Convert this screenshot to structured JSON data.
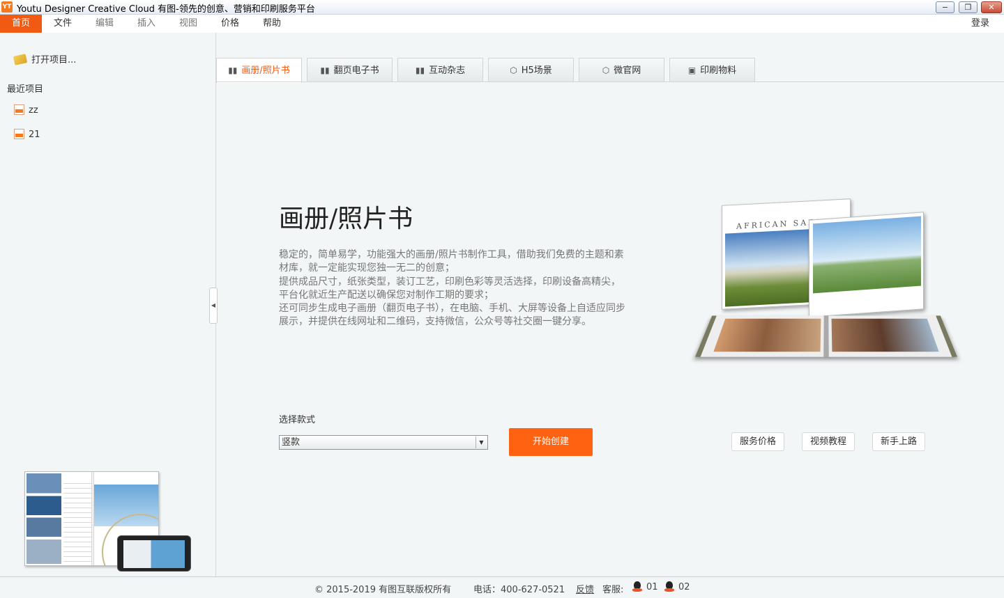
{
  "window": {
    "icon_text": "YT",
    "title": "Youtu Designer Creative Cloud 有图-领先的创意、营销和印刷服务平台",
    "min_symbol": "−",
    "max_symbol": "❐",
    "close_symbol": "✕"
  },
  "menu": {
    "items": [
      "首页",
      "文件",
      "编辑",
      "插入",
      "视图",
      "价格",
      "帮助"
    ],
    "login": "登录"
  },
  "sidebar": {
    "open_project": "打开项目...",
    "recent_title": "最近项目",
    "recent_items": [
      "zz",
      "21"
    ],
    "collapse_symbol": "◀"
  },
  "tabs": [
    {
      "label": "画册/照片书",
      "icon": "book-icon",
      "glyph": "▮▮"
    },
    {
      "label": "翻页电子书",
      "icon": "book-icon",
      "glyph": "▮▮"
    },
    {
      "label": "互动杂志",
      "icon": "book-icon",
      "glyph": "▮▮"
    },
    {
      "label": "H5场景",
      "icon": "html5-icon",
      "glyph": "⬡"
    },
    {
      "label": "微官网",
      "icon": "html5-icon",
      "glyph": "⬡"
    },
    {
      "label": "印刷物料",
      "icon": "print-icon",
      "glyph": "▣"
    }
  ],
  "main": {
    "title": "画册/照片书",
    "description": [
      "稳定的，简单易学，功能强大的画册/照片书制作工具，借助我们免费的主题和素材库，就一定能实现您独一无二的创意；",
      "提供成品尺寸，纸张类型，装订工艺，印刷色彩等灵活选择，印刷设备高精尖，平台化就近生产配送以确保您对制作工期的要求；",
      "还可同步生成电子画册（翻页电子书），在电脑、手机、大屏等设备上自适应同步展示，并提供在线网址和二维码，支持微信，公众号等社交圈一键分享。"
    ],
    "book_cover_title": "AFRICAN SAFARI",
    "style_label": "选择款式",
    "style_value": "竖款",
    "start_button": "开始创建",
    "links": [
      "服务价格",
      "视频教程",
      "新手上路"
    ]
  },
  "footer": {
    "copyright": "© 2015-2019 有图互联版权所有",
    "phone": "电话：400-627-0521",
    "feedback": "反馈",
    "service_label": "客服:",
    "service_1": "01",
    "service_2": "02"
  },
  "colors": {
    "accent": "#f05a12",
    "start_button": "#ff6210",
    "background": "#f2f6f6"
  }
}
